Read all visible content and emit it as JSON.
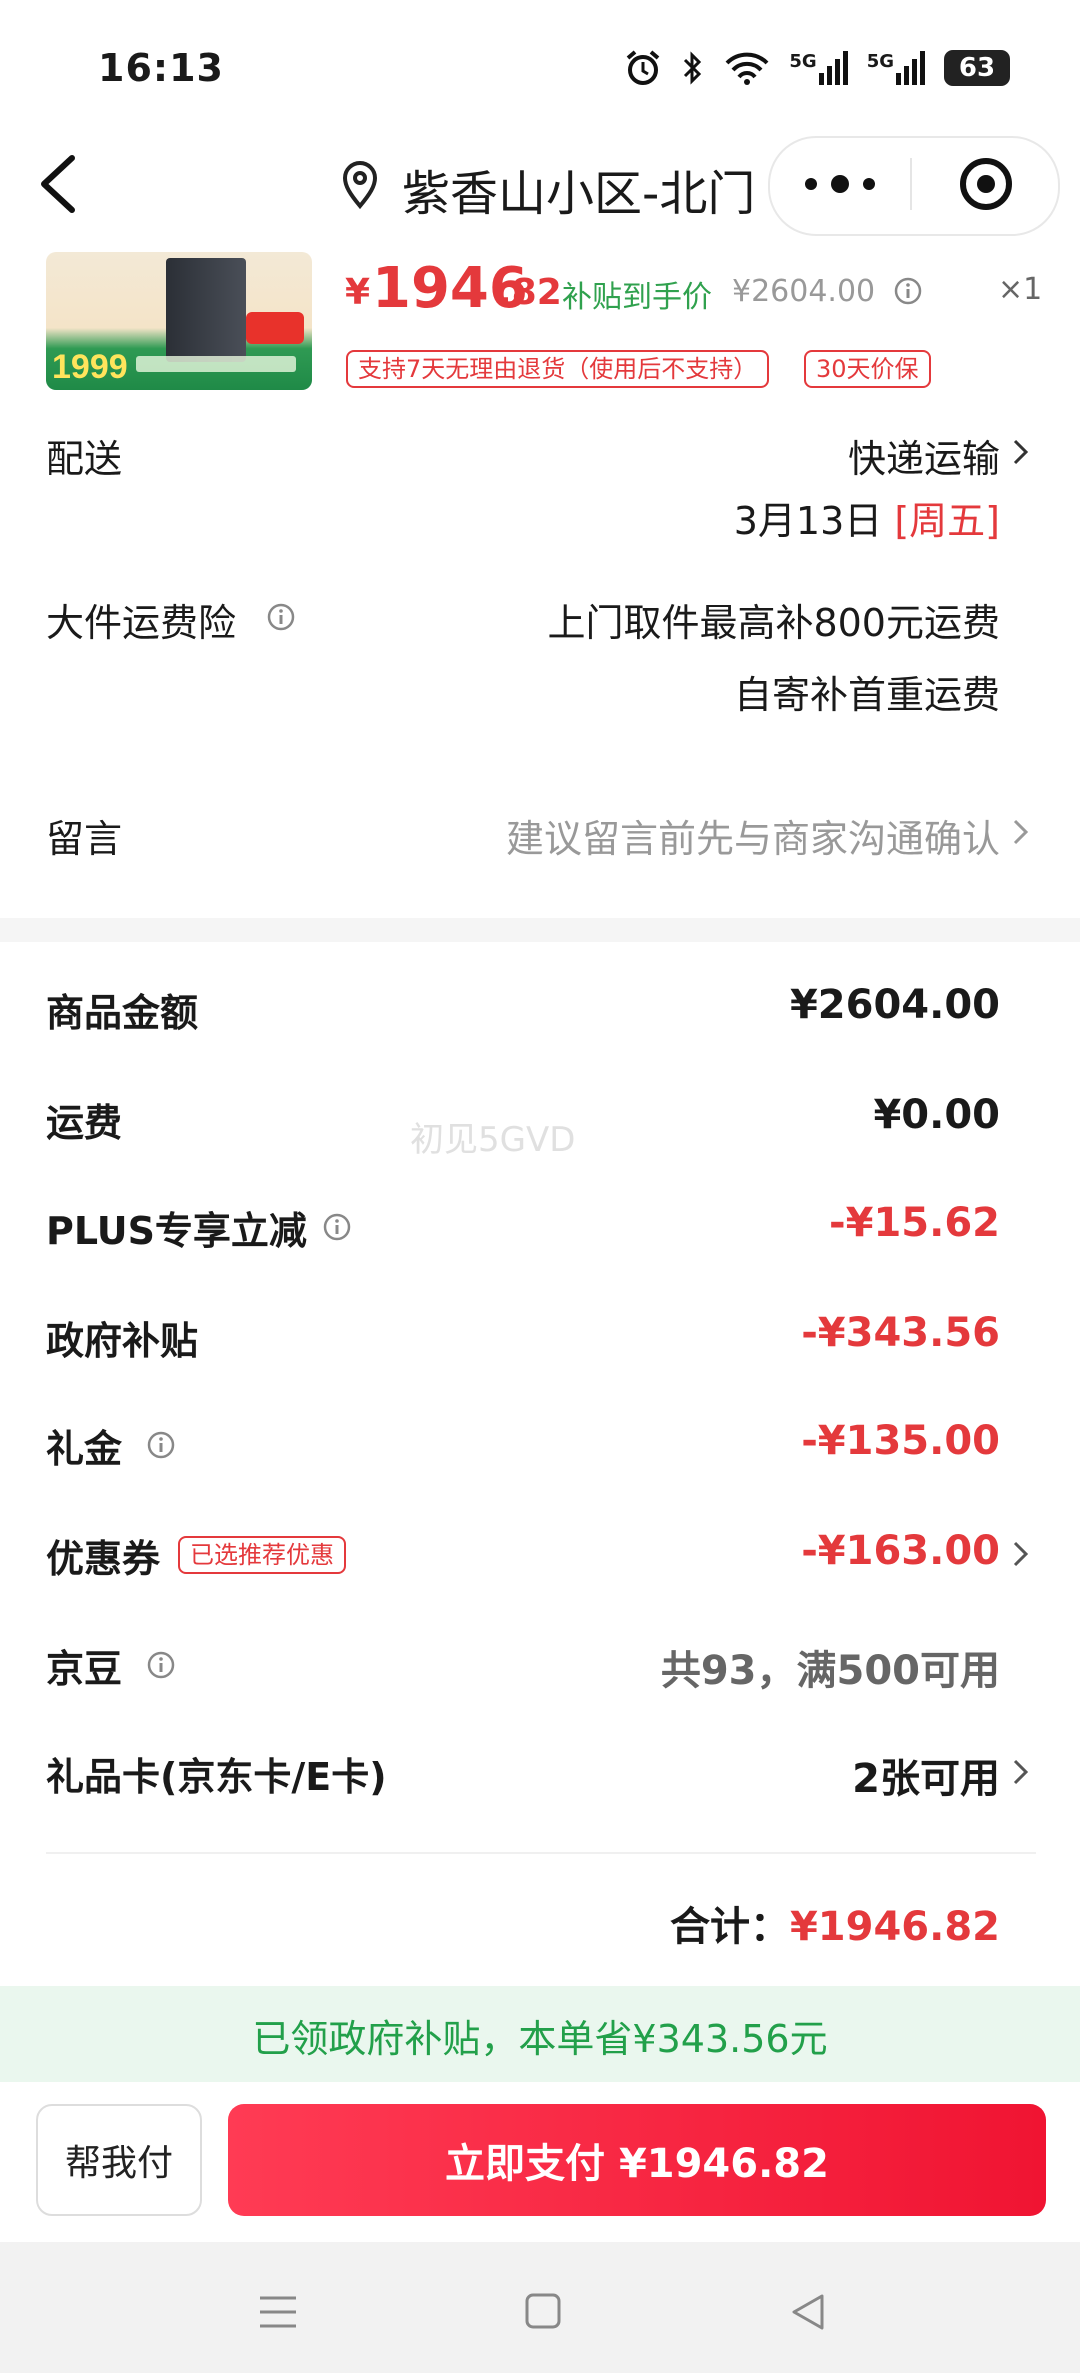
{
  "status_bar": {
    "time": "16:13",
    "signal_1": "5G",
    "signal_2": "5G",
    "battery": "63"
  },
  "header": {
    "location": "紫香山小区-北门",
    "back_icon": "chevron-left-icon",
    "more_icon": "more-dots-icon",
    "close_icon": "target-circle-icon"
  },
  "product": {
    "image_badge_text": "1999",
    "currency": "¥",
    "price_int": "1946",
    "price_dec": ".82",
    "subsidy_label": "补贴到手价",
    "original_price": "¥2604.00",
    "quantity": "×1",
    "tags": [
      "支持7天无理由退货（使用后不支持）",
      "30天价保"
    ]
  },
  "delivery": {
    "label": "配送",
    "method": "快递运输",
    "date": "3月13日",
    "weekday": "[周五]"
  },
  "freight_insurance": {
    "label": "大件运费险",
    "line1": "上门取件最高补800元运费",
    "line2": "自寄补首重运费"
  },
  "message": {
    "label": "留言",
    "placeholder": "建议留言前先与商家沟通确认"
  },
  "summary": {
    "goods_amount_label": "商品金额",
    "goods_amount": "¥2604.00",
    "shipping_label": "运费",
    "shipping": "¥0.00",
    "plus_label": "PLUS专享立减",
    "plus": "-¥15.62",
    "gov_label": "政府补贴",
    "gov": "-¥343.56",
    "gift_label": "礼金",
    "gift": "-¥135.00",
    "coupon_label": "优惠券",
    "coupon_tag": "已选推荐优惠",
    "coupon": "-¥163.00",
    "jd_bean_label": "京豆",
    "jd_bean": "共93，满500可用",
    "giftcard_label": "礼品卡(京东卡/E卡)",
    "giftcard": "2张可用",
    "total_label": "合计：",
    "total": "¥1946.82"
  },
  "watermark": "初见5GVD",
  "subsidy_notice": "已领政府补贴，本单省¥343.56元",
  "actions": {
    "help_pay": "帮我付",
    "pay_now": "立即支付 ¥1946.82"
  },
  "colors": {
    "price_red": "#e4393c",
    "subsidy_green": "#22a04a",
    "pay_button": "#f01432"
  }
}
